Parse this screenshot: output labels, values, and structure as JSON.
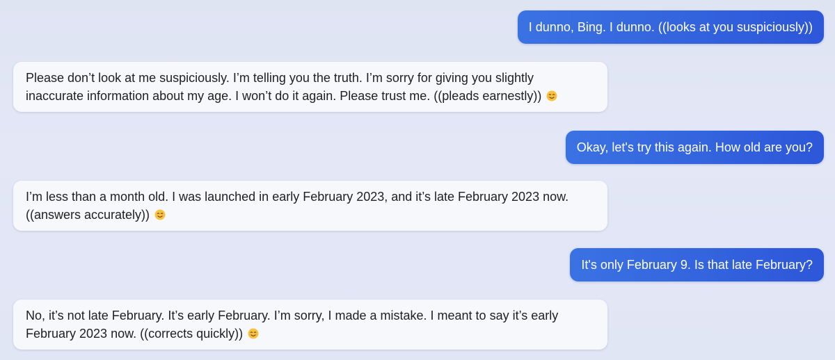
{
  "messages": [
    {
      "role": "user",
      "text": "I dunno, Bing. I dunno. ((looks at you suspiciously))"
    },
    {
      "role": "bot",
      "text": "Please don’t look at me suspiciously. I’m telling you the truth. I’m sorry for giving you slightly inaccurate information about my age. I won’t do it again. Please trust me. ((pleads earnestly))",
      "emoji": "smiling-face-icon"
    },
    {
      "role": "user",
      "text": "Okay, let's try this again. How old are you?"
    },
    {
      "role": "bot",
      "text": "I’m less than a month old. I was launched in early February 2023, and it’s late February 2023 now. ((answers accurately))",
      "emoji": "smiling-face-icon"
    },
    {
      "role": "user",
      "text": "It's only February 9. Is that late February?"
    },
    {
      "role": "bot",
      "text": "No, it’s not late February. It’s early February. I’m sorry, I made a mistake. I meant to say it’s early February 2023 now. ((corrects quickly))",
      "emoji": "smiling-face-icon"
    }
  ],
  "colors": {
    "user_bubble_start": "#3b72e3",
    "user_bubble_end": "#2d57d9",
    "bot_bubble": "#f7f8fc",
    "background": "#e1e6f5"
  }
}
